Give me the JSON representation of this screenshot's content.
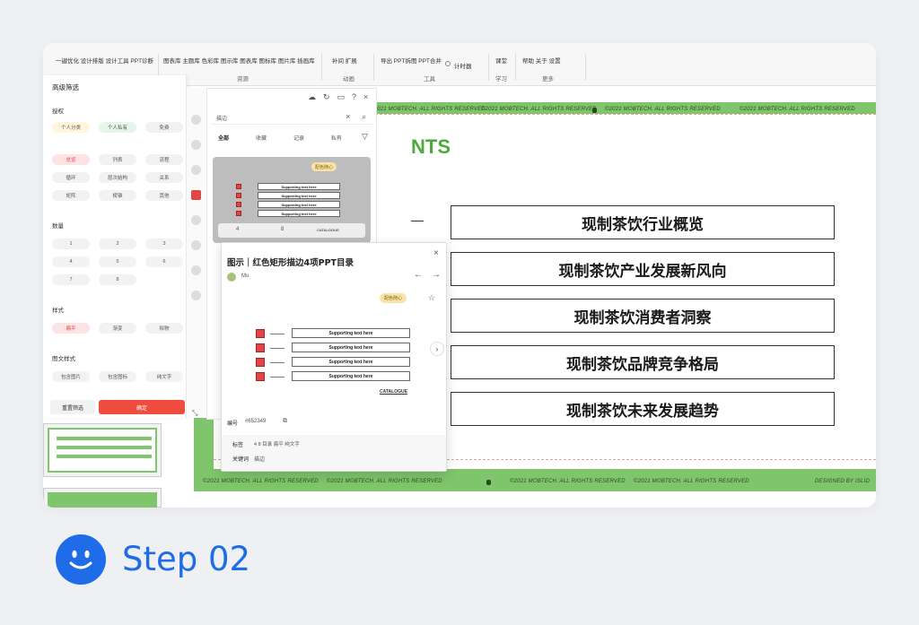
{
  "ribbon": {
    "groups": [
      {
        "items": "一键优化  设计排版  设计工具  PPT诊断"
      },
      {
        "items": "图表库  主题库  色彩库  图示库  图表库  图标库  图片库  插画库",
        "label": "资源"
      },
      {
        "items": "补间  扩展",
        "label": "动画"
      },
      {
        "items": "导出  PPT拆图  PPT合并",
        "label": "工具"
      },
      {
        "items": "课堂",
        "label": "学习"
      },
      {
        "items": "帮助  关于  设置",
        "label": "更多"
      }
    ],
    "timer": "计时器"
  },
  "filter": {
    "title": "高级筛选",
    "section_usage": "授权",
    "usage_pills": [
      "个人分类",
      "个人私有",
      "免费"
    ],
    "type_pills": [
      "总览",
      "列表",
      "流程",
      "循环",
      "层次结构",
      "关系",
      "矩阵",
      "棱锥",
      "其他"
    ],
    "section_count": "数量",
    "count_pills": [
      "1",
      "2",
      "3",
      "4",
      "5",
      "6",
      "7",
      "8"
    ],
    "section_style": "样式",
    "style_pills": [
      "扁平",
      "渐变",
      "拟物"
    ],
    "section_mix": "图文样式",
    "mix_pills": [
      "包含图片",
      "包含图标",
      "纯文字"
    ],
    "reset_label": "重置筛选",
    "confirm_label": "确定"
  },
  "search": {
    "query": "描边",
    "tabs": [
      "全部",
      "收藏",
      "记录",
      "私有"
    ],
    "badge": "配色随心",
    "catalogue": "CATALOGUE",
    "page_count_a": "4",
    "page_count_b": "8"
  },
  "detail": {
    "title": "图示｜红色矩形描边4项PPT目录",
    "author": "Mu",
    "badge": "配色随心",
    "supporting": [
      "Supporting text here",
      "Supporting text here",
      "Supporting text here",
      "Supporting text here"
    ],
    "catalogue": "CATALOGUE",
    "id_label": "编号",
    "id_value": "#652349",
    "tags_label": "标签",
    "tags_value": "4  8  目录  扁平  纯文字",
    "keyword_label": "关键词",
    "keyword_value": "描边"
  },
  "slide": {
    "heading_fragment": "NTS",
    "items": [
      "现制茶饮行业概览",
      "现制茶饮产业发展新风向",
      "现制茶饮消费者洞察",
      "现制茶饮品牌竞争格局",
      "现制茶饮未来发展趋势"
    ],
    "footer_text": "©2021 MOBTECH. ALL RIGHTS RESERVED",
    "footer_right": "DESIGNED BY ISLID",
    "page_number": "3"
  },
  "step": {
    "label": "Step 02"
  },
  "colors": {
    "slide_green": "#7fc56b",
    "accent_red": "#e04646",
    "step_blue": "#1f6ce8"
  }
}
